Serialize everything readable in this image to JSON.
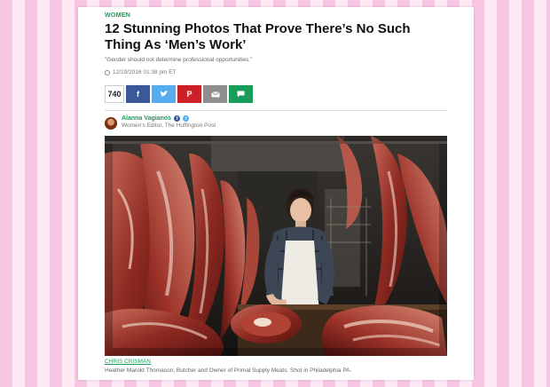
{
  "article": {
    "section": "WOMEN",
    "headline": "12 Stunning Photos That Prove There’s No Such Thing As ‘Men’s Work’",
    "subhead": "\"Gender should not determine professional opportunities.\"",
    "timestamp": "12/19/2016 01:38 pm ET"
  },
  "share": {
    "count": "740",
    "icons": [
      "facebook-icon",
      "twitter-icon",
      "pinterest-icon",
      "email-icon",
      "comment-icon"
    ]
  },
  "author": {
    "name": "Alanna Vagianos",
    "role": "Women's Editor, The Huffington Post"
  },
  "photo": {
    "credit": "CHRIS CRISMAN",
    "caption": "Heather Marold Thomason; Butcher and Owner of Primal Supply Meats. Shot in Philadelphia PA."
  },
  "colors": {
    "accent": "#1a9c5a",
    "facebook": "#3b5998",
    "twitter": "#55acee",
    "pinterest": "#cb2027",
    "email": "#8e8e8e",
    "comment": "#1a9c5a",
    "background_stripe_1": "#f6c6e2",
    "background_stripe_2": "#fde8f4"
  }
}
